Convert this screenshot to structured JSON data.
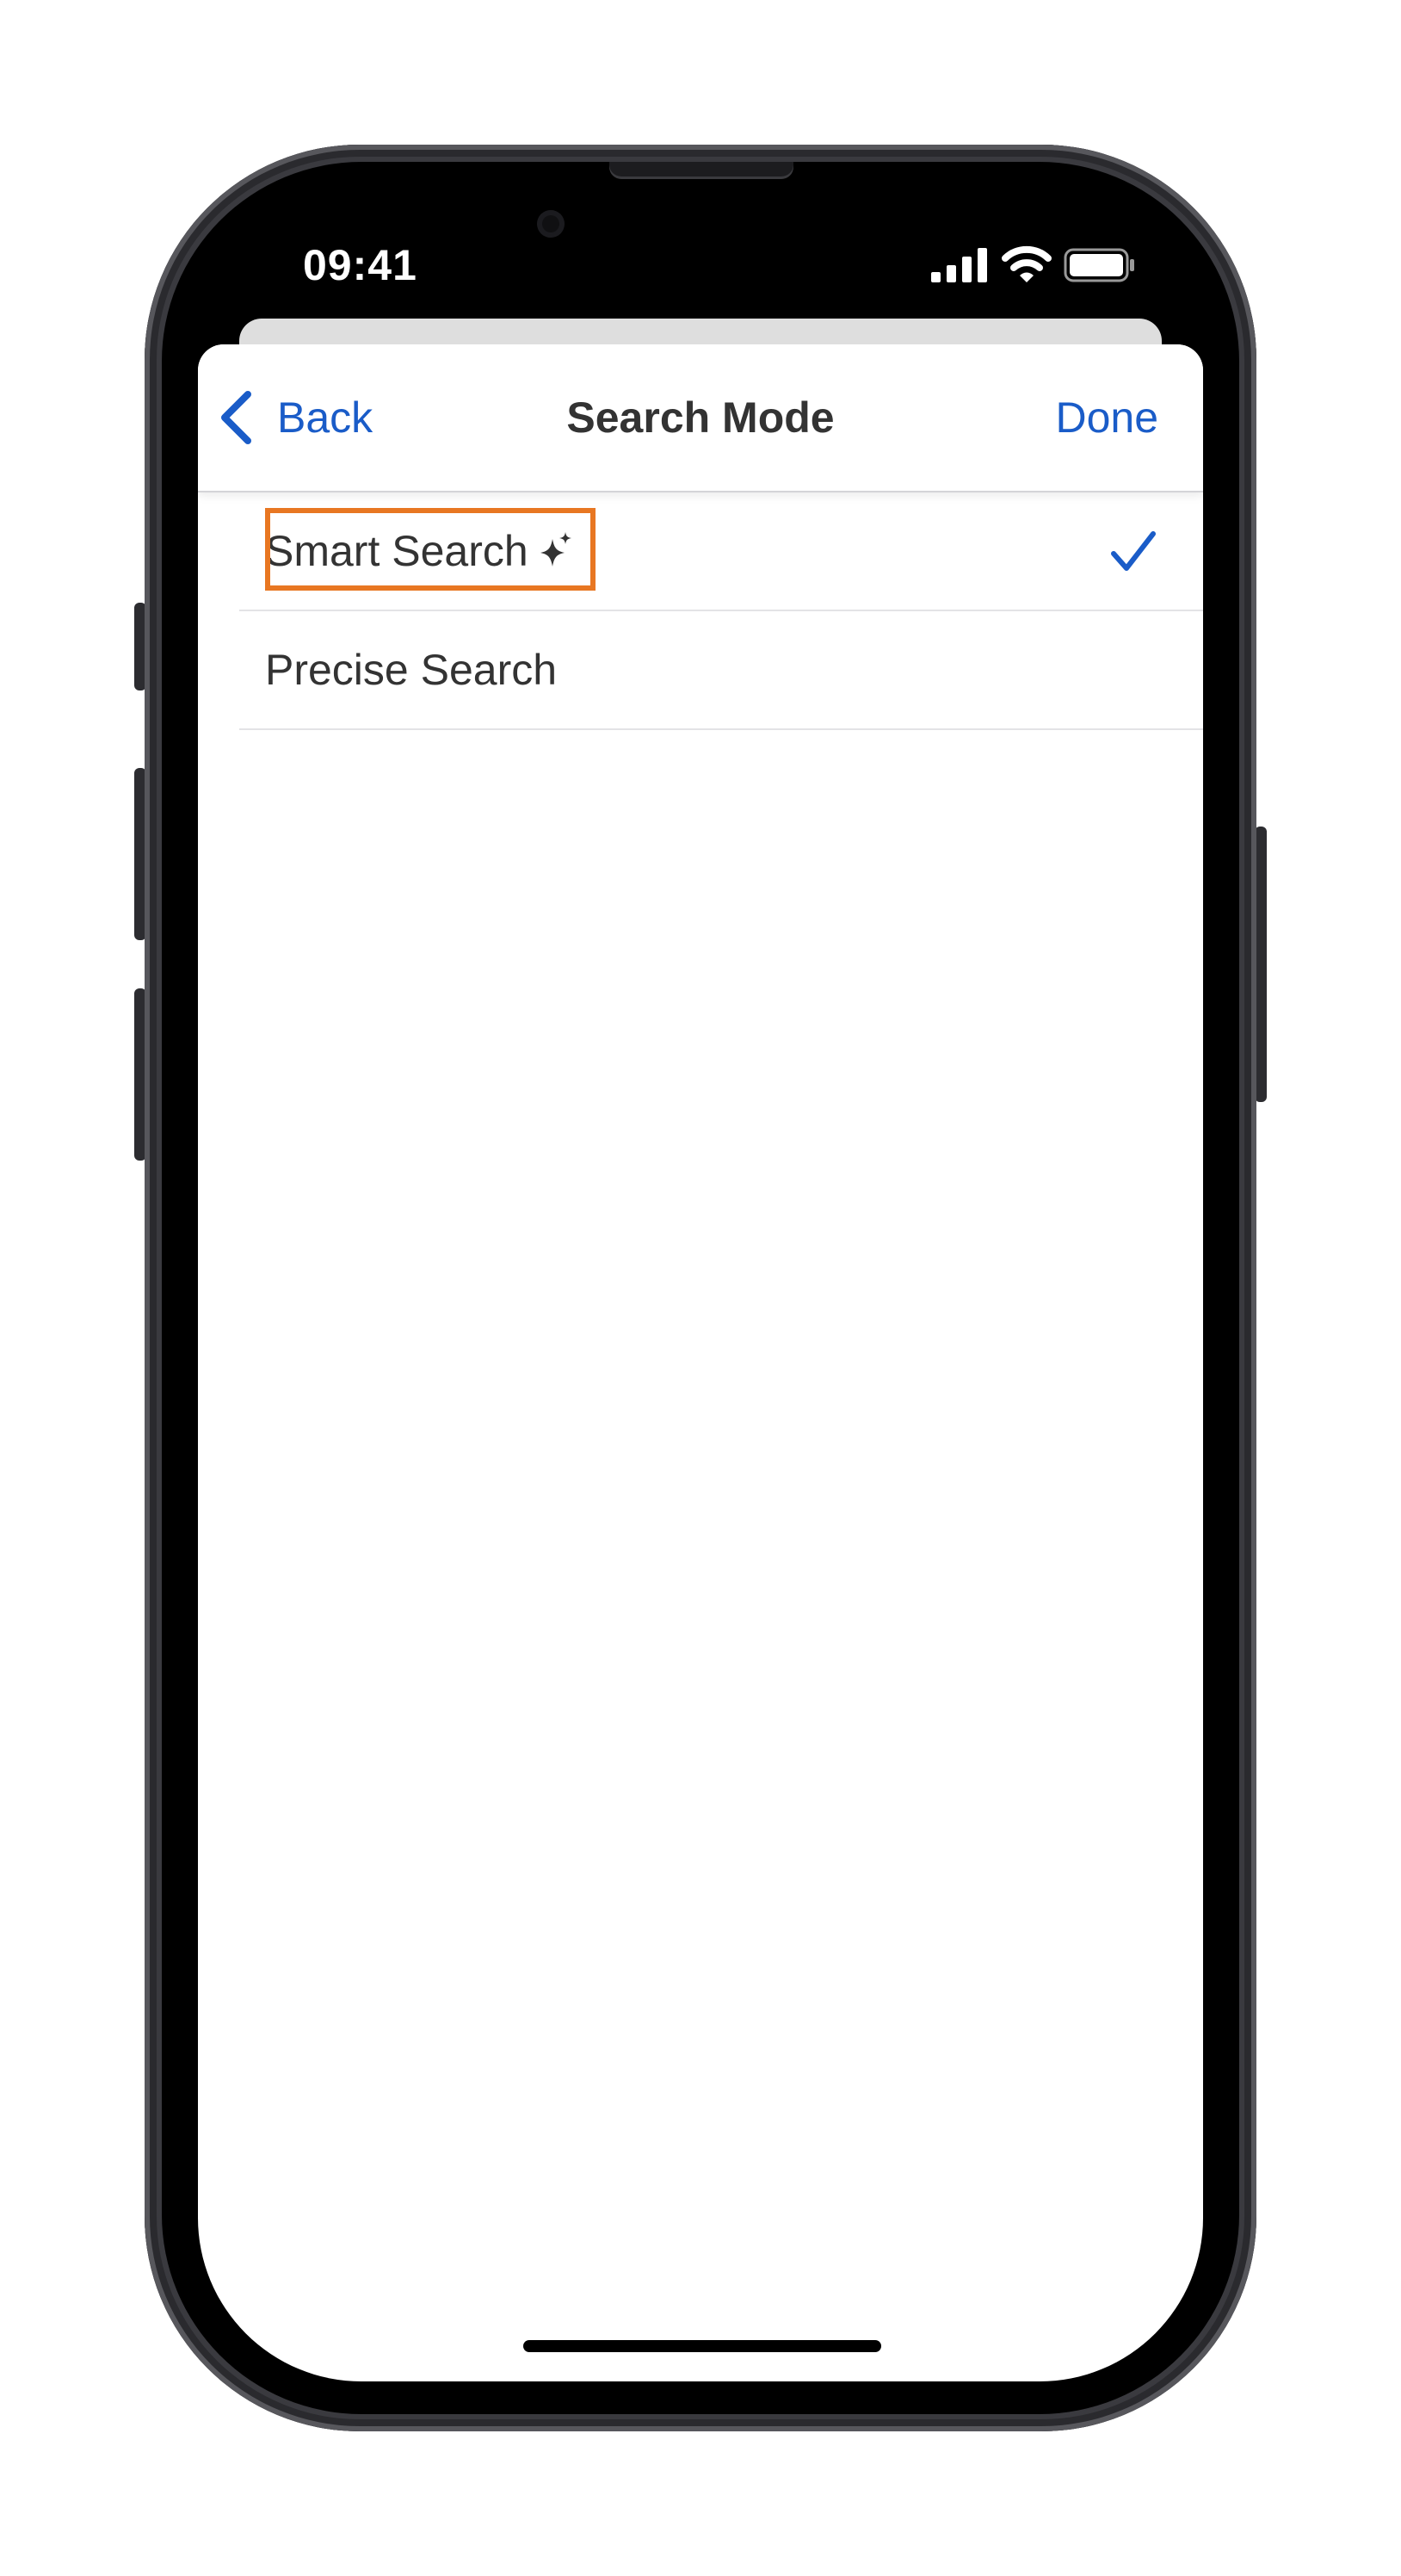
{
  "status_bar": {
    "time": "09:41",
    "icons": [
      "cellular-signal-icon",
      "wifi-icon",
      "battery-icon"
    ]
  },
  "nav": {
    "back_label": "Back",
    "title": "Search Mode",
    "done_label": "Done"
  },
  "options": [
    {
      "label": "Smart Search",
      "icon": "sparkle-icon",
      "selected": true,
      "highlighted": true
    },
    {
      "label": "Precise Search",
      "selected": false
    }
  ],
  "colors": {
    "accent": "#1a5cc8",
    "text": "#333333",
    "highlight_border": "#e87722",
    "separator": "#e3e3e6"
  }
}
